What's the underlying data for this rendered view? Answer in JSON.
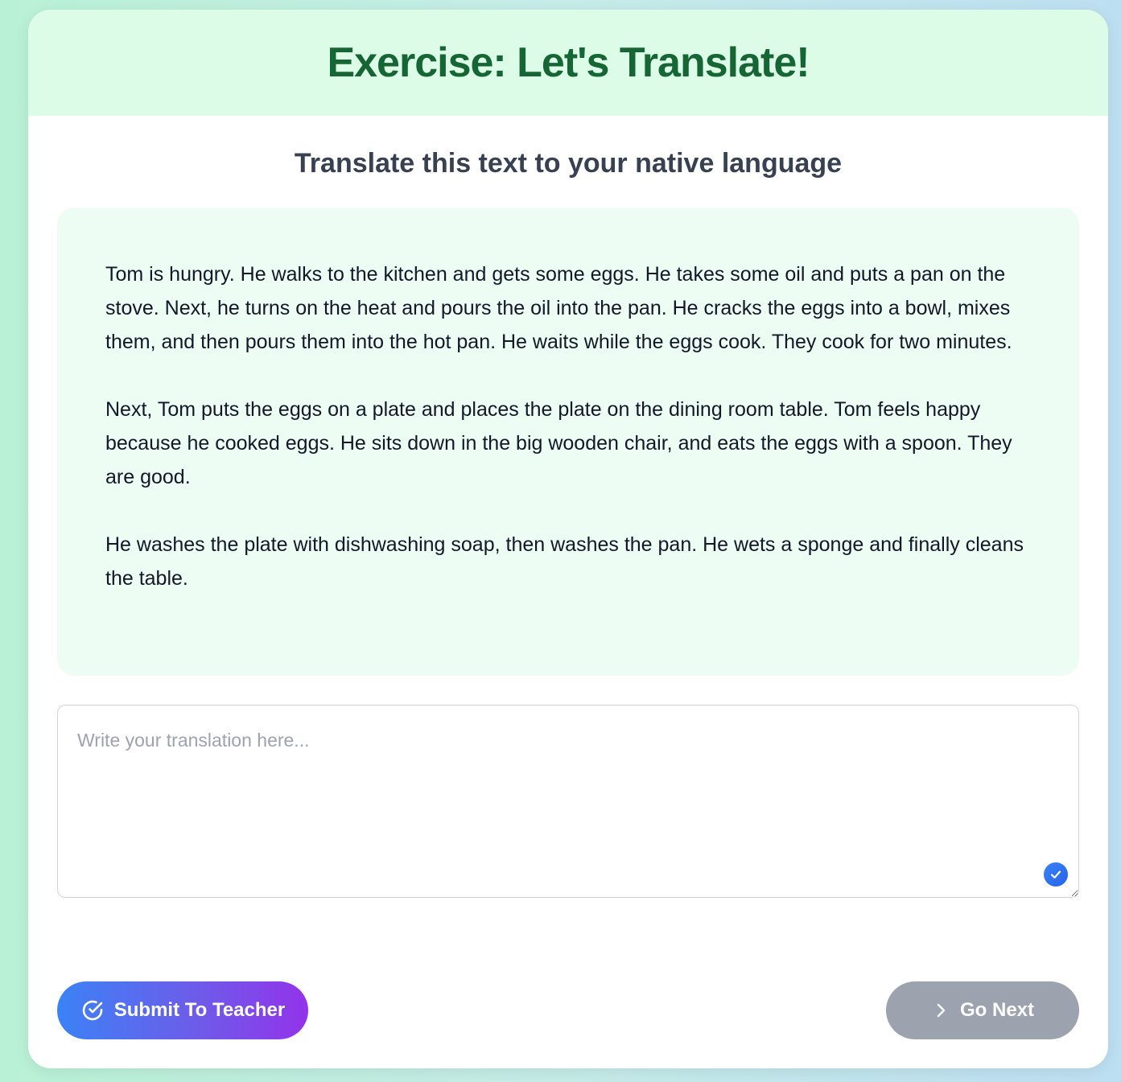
{
  "header": {
    "title": "Exercise: Let's Translate!"
  },
  "instruction": "Translate this text to your native language",
  "source_text": {
    "paragraphs": [
      "Tom is hungry. He walks to the kitchen and gets some eggs. He takes some oil and puts a pan on the stove. Next, he turns on the heat and pours the oil into the pan. He cracks the eggs into a bowl, mixes them, and then pours them into the hot pan. He waits while the eggs cook. They cook for two minutes.",
      "Next, Tom puts the eggs on a plate and places the plate on the dining room table. Tom feels happy because he cooked eggs. He sits down in the big wooden chair, and eats the eggs with a spoon. They are good.",
      "He washes the plate with dishwashing soap, then washes the pan. He wets a sponge and finally cleans the table."
    ]
  },
  "translation": {
    "value": "",
    "placeholder": "Write your translation here..."
  },
  "buttons": {
    "submit_label": "Submit To Teacher",
    "submit_icon": "check-circle-icon",
    "next_label": "Go Next",
    "next_icon": "chevron-right-icon"
  },
  "colors": {
    "header_bg": "#dcfce7",
    "title_color": "#166534",
    "source_bg": "#edfdf3",
    "submit_gradient_start": "#3b82f6",
    "submit_gradient_end": "#9333ea",
    "next_bg": "#9ca3af"
  }
}
